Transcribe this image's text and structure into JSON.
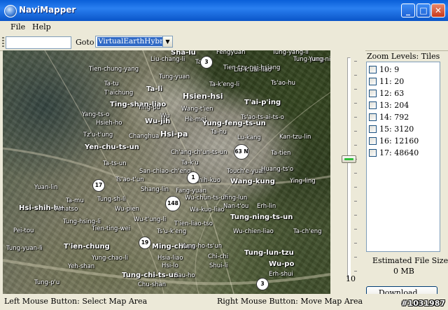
{
  "window": {
    "title": "NaviMapper"
  },
  "menu": {
    "file": "File",
    "help": "Help"
  },
  "toolbar": {
    "path_value": "",
    "goto_label": "Goto",
    "map_source": "VirtualEarthHybrid"
  },
  "map": {
    "labels": [
      "Sha-lu",
      "Fengyuan",
      "Tung-yang-li",
      "Tung-yang",
      "Yung-ning",
      "Liu-chang-li",
      "Ta-ya",
      "Tien-tzu-nei-hsiang",
      "Tien-chung-yang",
      "Tung-yuan",
      "Liu-k'uai-liao",
      "Ta-tu",
      "Ta-li",
      "Ta-k'eng-li",
      "Ts'ao-hu",
      "T'aichung",
      "Hsien-hsi",
      "Ting-shan-liao",
      "Ying-pu",
      "Wang-t'ien",
      "T'ai-p'ing",
      "Yang-ts-o",
      "Hsieh-ho",
      "Wu",
      "Hè-mei",
      "Wu-jih",
      "Yung-feng-ts-un",
      "Ts'ao-ts-ai-ts-o",
      "Tz'u-t'ung",
      "Changhua",
      "Hsi-pa",
      "Ta-hu",
      "Lu-kang",
      "Kan-tzu-lin",
      "Yen-chu-ts-un",
      "Ta-tien",
      "Ch'ang-ch'un-ts-un",
      "Ta-ts-un",
      "Ta-k'u",
      "San-chiao-ch'eng",
      "Touch'e-yuan",
      "Huang-ts'o",
      "Ts'ao-t'un",
      "Ta-shih-kuo",
      "Wang-kung",
      "Ying-ling",
      "Yuan-lin",
      "Shang-lin",
      "Fang-yuan",
      "Ting-lun",
      "Hsi-shih-hu",
      "Ta-mu",
      "Tung-sh-li",
      "Wu-chün-ts-un",
      "Amatso",
      "Wu-pien",
      "Wa-kuo-liao",
      "Nan-t'ou",
      "Erh-lin",
      "Tung-ning-ts-un",
      "Tung-hsing-li",
      "Wu-t'ung-li",
      "Tien-ting-wei",
      "T'ien-liao-tso",
      "Ts'u-k'eng",
      "Wu-chien-liao",
      "Ta-ch'eng",
      "Pei-tou",
      "T'ien-chung",
      "Ming-chien",
      "Yung-ho-ts'un",
      "Tung-lun-tzu",
      "Tung-yuan-li",
      "Yung-chao-li",
      "Hsia-liao",
      "Chi-chi",
      "Yeh-shan",
      "Hsi-lo",
      "Wu-po",
      "Shui-li",
      "Tung-chi-ts-un",
      "Sau-ho",
      "Erh-shui",
      "Tung-p'u",
      "Chu-shan"
    ],
    "shields": [
      "3",
      "63 N",
      "1",
      "17",
      "148",
      "19",
      "3"
    ]
  },
  "zoom": {
    "current": "10",
    "header": "Zoom Levels: Tiles",
    "levels": [
      {
        "label": "10: 9",
        "checked": false
      },
      {
        "label": "11: 20",
        "checked": false
      },
      {
        "label": "12: 63",
        "checked": false
      },
      {
        "label": "13: 204",
        "checked": false
      },
      {
        "label": "14: 792",
        "checked": false
      },
      {
        "label": "15: 3120",
        "checked": false
      },
      {
        "label": "16: 12160",
        "checked": false
      },
      {
        "label": "17: 48640",
        "checked": false
      }
    ]
  },
  "file_size": {
    "label": "Estimated File Size:",
    "value": "0 MB"
  },
  "download_label": "Download...",
  "status": {
    "left": "Left Mouse Button: Select Map Area",
    "right": "Right Mouse Button: Move Map Area"
  },
  "watermark": "#1031987"
}
